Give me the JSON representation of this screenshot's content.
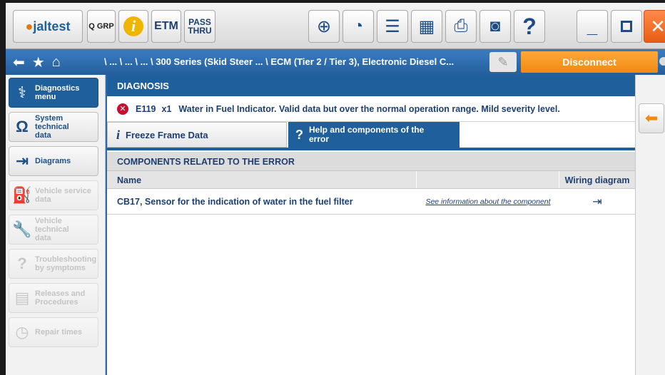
{
  "toolbar": {
    "logo_prefix": "",
    "logo_text": "jaltest",
    "qgrp_label": "Q GRP",
    "info_glyph": "i",
    "etm_label": "ETM",
    "pass_label_1": "PASS",
    "pass_label_2": "THRU",
    "help_glyph": "?",
    "close_glyph": "✕"
  },
  "navbar": {
    "breadcrumb": "\\ ... \\ ... \\ ... \\ 300 Series (Skid Steer ...  \\ ECM (Tier 2 / Tier 3), Electronic Diesel C...",
    "disconnect_label": "Disconnect"
  },
  "sidebar": {
    "items": [
      {
        "label_1": "Diagnostics",
        "label_2": "menu",
        "icon": "stethoscope-icon",
        "state": "active"
      },
      {
        "label_1": "System technical",
        "label_2": "data",
        "icon": "omega-icon",
        "state": "normal"
      },
      {
        "label_1": "Diagrams",
        "label_2": "",
        "icon": "connector-icon",
        "state": "normal"
      },
      {
        "label_1": "Vehicle service",
        "label_2": "data",
        "icon": "oil-can-icon",
        "state": "disabled"
      },
      {
        "label_1": "Vehicle technical",
        "label_2": "data",
        "icon": "wrench-icon",
        "state": "disabled"
      },
      {
        "label_1": "Troubleshooting",
        "label_2": "by symptoms",
        "icon": "question-wrench-icon",
        "state": "disabled"
      },
      {
        "label_1": "Releases and",
        "label_2": "Procedures",
        "icon": "document-icon",
        "state": "disabled"
      },
      {
        "label_1": "Repair times",
        "label_2": "",
        "icon": "stopwatch-icon",
        "state": "disabled"
      }
    ]
  },
  "main": {
    "header": "DIAGNOSIS",
    "error": {
      "code": "E119",
      "multiplier": "x1",
      "description": "Water in Fuel Indicator. Valid data but over the normal operation range. Mild severity level."
    },
    "tabs": {
      "freeze_frame": "Freeze Frame Data",
      "help_1": "Help and components of the",
      "help_2": "error"
    },
    "section_title": "COMPONENTS RELATED TO THE ERROR",
    "table": {
      "columns": [
        "Name",
        "",
        "Wiring diagram"
      ],
      "rows": [
        {
          "name": "CB17, Sensor for the indication of water in the fuel filter",
          "link": "See information about the component"
        }
      ]
    }
  },
  "colors": {
    "primary_blue": "#1f5f9c",
    "accent_orange": "#f08a10",
    "close_red": "#e85d16",
    "error_red": "#c8102e"
  }
}
